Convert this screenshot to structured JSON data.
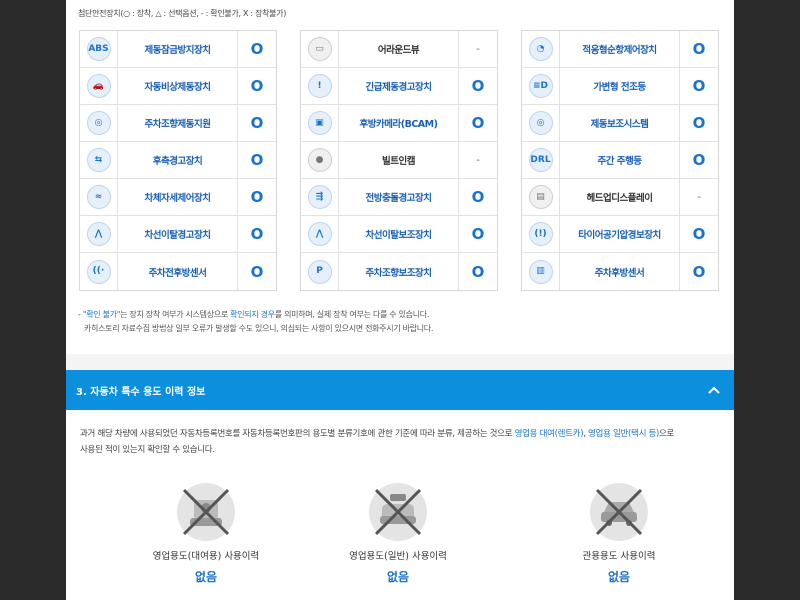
{
  "legend": "첨단안전장치(○ : 장착, △ : 선택옵션, - : 확인불가, X : 장착불가)",
  "columns": [
    [
      {
        "icon": "abs-icon",
        "icon_text": "ABS",
        "name": "제동잠금방지장치",
        "value": "O"
      },
      {
        "icon": "emergency-brake-icon",
        "icon_text": "🚗",
        "name": "자동비상제동장치",
        "value": "O"
      },
      {
        "icon": "steering-brake-icon",
        "icon_text": "◎",
        "name": "주차조향제동지원",
        "value": "O"
      },
      {
        "icon": "rear-side-warning-icon",
        "icon_text": "⇆",
        "name": "후측경고장치",
        "value": "O"
      },
      {
        "icon": "stability-control-icon",
        "icon_text": "≈",
        "name": "차체자세제어장치",
        "value": "O"
      },
      {
        "icon": "lane-departure-icon",
        "icon_text": "⋀",
        "name": "차선이탈경고장치",
        "value": "O"
      },
      {
        "icon": "parking-sensor-front-icon",
        "icon_text": "((·",
        "name": "주차전후방센서",
        "value": "O"
      }
    ],
    [
      {
        "icon": "around-view-icon",
        "icon_text": "▭",
        "name": "어라운드뷰",
        "value": "-",
        "dark": true
      },
      {
        "icon": "emergency-brake-warning-icon",
        "icon_text": "!",
        "name": "긴급제동경고장치",
        "value": "O"
      },
      {
        "icon": "rear-camera-icon",
        "icon_text": "▣",
        "name": "후방카메라(BCAM)",
        "value": "O"
      },
      {
        "icon": "builtin-cam-icon",
        "icon_text": "●",
        "name": "빌트인캠",
        "value": "-",
        "dark": true
      },
      {
        "icon": "front-collision-icon",
        "icon_text": "⇶",
        "name": "전방충돌경고장치",
        "value": "O"
      },
      {
        "icon": "lane-keeping-icon",
        "icon_text": "⋀",
        "name": "차선이탈보조장치",
        "value": "O"
      },
      {
        "icon": "parking-assist-icon",
        "icon_text": "P",
        "name": "주차조향보조장치",
        "value": "O"
      }
    ],
    [
      {
        "icon": "adaptive-cruise-icon",
        "icon_text": "◔",
        "name": "적응형순항제어장치",
        "value": "O"
      },
      {
        "icon": "adaptive-headlight-icon",
        "icon_text": "≡D",
        "name": "가변형 전조등",
        "value": "O"
      },
      {
        "icon": "brake-assist-icon",
        "icon_text": "◎",
        "name": "제동보조시스템",
        "value": "O"
      },
      {
        "icon": "daytime-light-icon",
        "icon_text": "DRL",
        "name": "주간 주행등",
        "value": "O"
      },
      {
        "icon": "head-up-display-icon",
        "icon_text": "▤",
        "name": "헤드업디스플레이",
        "value": "-",
        "dark": true
      },
      {
        "icon": "tire-pressure-icon",
        "icon_text": "(!)",
        "name": "타이어공기압경보장치",
        "value": "O"
      },
      {
        "icon": "parking-sensor-rear-icon",
        "icon_text": "▥",
        "name": "주차후방센서",
        "value": "O"
      }
    ]
  ],
  "note": {
    "line1_prefix": "- ",
    "line1_highlight": "\"확인 불가\"",
    "line1_mid": "는 장치 장착 여부가 시스템상으로 ",
    "line1_highlight2": "확인되지 경우",
    "line1_suffix": "를 의미하며, 실제 장착 여부는 다를 수 있습니다.",
    "line2": "카히스토리 자료수집 방법상 일부 오류가 발생할 수도 있으니, 의심되는 사항이 있으시면 전화주시기 바랍니다."
  },
  "section3": {
    "title": "3. 자동차 특수 용도 이력 정보",
    "desc_prefix": "과거 해당 차량에 사용되었던 자동차등록번호를 자동차등록번호판의 용도별 분류기호에 관한 기준에 따라 분류, 제공하는 것으로 ",
    "desc_hl1": "영업용 대여(렌트카)",
    "desc_mid": ", ",
    "desc_hl2": "영업용 일반(택시 등)",
    "desc_suffix": "으로",
    "desc_line2": "사용된 적이 있는지 확인할 수 있습니다.",
    "items": [
      {
        "icon": "rental-car-icon",
        "label": "영업용도(대여용) 사용이력",
        "value": "없음"
      },
      {
        "icon": "taxi-icon",
        "label": "영업용도(일반) 사용이력",
        "value": "없음"
      },
      {
        "icon": "government-car-icon",
        "label": "관용용도 사용이력",
        "value": "없음"
      }
    ]
  },
  "colors": {
    "accent": "#0c8fdc",
    "value_blue": "#1a73c9"
  }
}
